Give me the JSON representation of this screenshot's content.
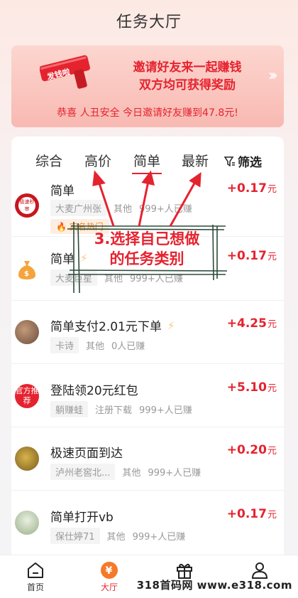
{
  "header": {
    "title": "任务大厅"
  },
  "banner": {
    "gun_label": "发钱啦",
    "line1": "邀请好友来一起赚钱",
    "line2": "双方均可获得奖励",
    "notice": "恭喜 人丑安全 今日邀请好友赚到47.8元!"
  },
  "tabs": [
    {
      "label": "综合",
      "active": false
    },
    {
      "label": "高价",
      "active": false
    },
    {
      "label": "简单",
      "active": true
    },
    {
      "label": "最新",
      "active": false
    }
  ],
  "filter_label": "筛选",
  "tasks": [
    {
      "name": "简单",
      "avatar_text": "极速秒审",
      "tag": "大麦广州张",
      "category": "其他",
      "count": "999+人已赚",
      "price": "+0.17",
      "unit": "元",
      "hot": "实名热门"
    },
    {
      "name": "简单",
      "avatar_text": "",
      "tag": "大麦巨星",
      "category": "其他",
      "count": "999+人已赚",
      "price": "+0.17",
      "unit": "元",
      "bolt": true
    },
    {
      "name": "简单支付2.01元下单",
      "avatar_text": "",
      "tag": "卡诗",
      "category": "其他",
      "count": "0人已赚",
      "price": "+4.25",
      "unit": "元",
      "bolt": true
    },
    {
      "name": "登陆领20元红包",
      "avatar_text": "官方推荐",
      "tag": "躺赚蛙",
      "category": "注册下载",
      "count": "999+人已赚",
      "price": "+5.10",
      "unit": "元"
    },
    {
      "name": "极速页面到达",
      "avatar_text": "",
      "tag": "泸州老窖北...",
      "category": "其他",
      "count": "999+人已赚",
      "price": "+0.20",
      "unit": "元"
    },
    {
      "name": "简单打开vb",
      "avatar_text": "",
      "tag": "保仕婷71",
      "category": "其他",
      "count": "999+人已赚",
      "price": "+0.17",
      "unit": "元"
    }
  ],
  "annotation": {
    "line1": "3.选择自己想做",
    "line2": "的任务类别"
  },
  "tabbar": [
    {
      "label": "首页",
      "icon": "home-icon"
    },
    {
      "label": "大厅",
      "icon": "yen-icon",
      "active": true
    },
    {
      "label": "",
      "icon": "gift-icon"
    },
    {
      "label": "",
      "icon": "user-icon"
    }
  ],
  "watermark": "318首码网 www.e318.com",
  "colors": {
    "accent": "#e5232f",
    "banner": "#f8b9b2"
  }
}
